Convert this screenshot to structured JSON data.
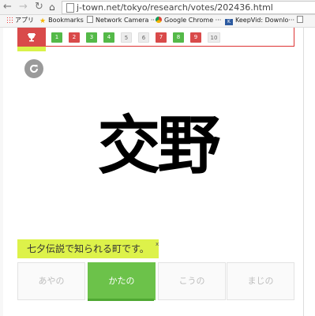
{
  "browser": {
    "url": "j-town.net/tokyo/research/votes/202436.html",
    "bookmarks": [
      {
        "label": "アプリ",
        "icon": "apps-icon"
      },
      {
        "label": "Bookmarks",
        "icon": "star-icon"
      },
      {
        "label": "Network Camera ···",
        "icon": "page-icon"
      },
      {
        "label": "Google Chrome ···",
        "icon": "chrome-icon"
      },
      {
        "label": "KeepVid: Downlo···",
        "icon": "keepvid-icon"
      }
    ]
  },
  "nav": {
    "vote_numbers": [
      {
        "label": "1",
        "color": "#54b948"
      },
      {
        "label": "2",
        "color": "#d94a4a"
      },
      {
        "label": "3",
        "color": "#54b948"
      },
      {
        "label": "4",
        "color": "#54b948"
      },
      {
        "label": "5",
        "color": "#ececec"
      },
      {
        "label": "6",
        "color": "#ececec"
      },
      {
        "label": "7",
        "color": "#d94a4a"
      },
      {
        "label": "8",
        "color": "#54b948"
      },
      {
        "label": "9",
        "color": "#d94a4a"
      },
      {
        "label": "10",
        "color": "#ececec"
      }
    ]
  },
  "quiz": {
    "kanji": "交野",
    "hint": "七夕伝説で知られる町です。",
    "hint_close": "x",
    "choices": [
      {
        "label": "あやの",
        "selected": false
      },
      {
        "label": "かたの",
        "selected": true
      },
      {
        "label": "こうの",
        "selected": false
      },
      {
        "label": "まじの",
        "selected": false
      }
    ]
  },
  "colors": {
    "accent_red": "#d94a4a",
    "accent_green": "#6cc24a",
    "hint_bg": "#ddf24a"
  }
}
